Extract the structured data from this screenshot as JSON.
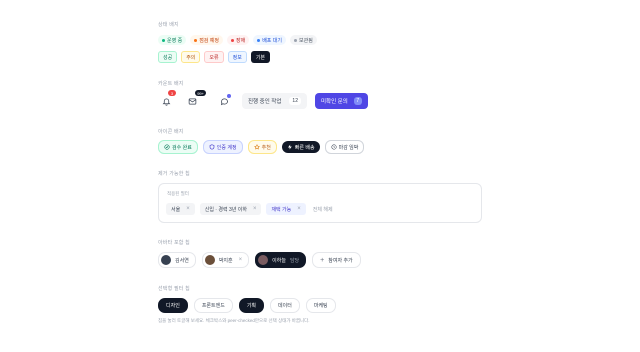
{
  "sections": {
    "status": "상태 배지",
    "counter": "카운트 배지",
    "icon": "아이콘 배지",
    "removable": "제거 가능한 칩",
    "avatar": "아바타 포함 칩",
    "selectable": "선택형 필터 칩"
  },
  "status_badges": [
    {
      "label": "운영 중",
      "variant": "green"
    },
    {
      "label": "점검 예정",
      "variant": "orange"
    },
    {
      "label": "장애",
      "variant": "red"
    },
    {
      "label": "배포 대기",
      "variant": "blue"
    },
    {
      "label": "보관됨",
      "variant": "gray"
    }
  ],
  "tone_badges": [
    {
      "label": "성공",
      "variant": "success"
    },
    {
      "label": "주의",
      "variant": "warn"
    },
    {
      "label": "오류",
      "variant": "err"
    },
    {
      "label": "정보",
      "variant": "info"
    },
    {
      "label": "기본",
      "variant": "def"
    }
  ],
  "counters": {
    "bell_count": "3",
    "mail_count": "99+",
    "in_progress_label": "진행 중인 작업",
    "in_progress_count": "12",
    "unread_label": "미확인 문의",
    "unread_count": "7"
  },
  "icon_badges": [
    {
      "label": "검수 완료",
      "icon": "check-circle-icon",
      "variant": "green"
    },
    {
      "label": "인증 계정",
      "icon": "shield-icon",
      "variant": "blue"
    },
    {
      "label": "추천",
      "icon": "star-icon",
      "variant": "amber"
    },
    {
      "label": "빠른 배송",
      "icon": "bolt-icon",
      "variant": "dark"
    },
    {
      "label": "마감 임박",
      "icon": "clock-icon",
      "variant": "white"
    }
  ],
  "removable": {
    "placeholder": "적용된 필터",
    "chips": [
      {
        "label": "서울",
        "variant": "gray"
      },
      {
        "label": "신입 · 경력 3년 이하",
        "variant": "gray"
      },
      {
        "label": "재택 가능",
        "variant": "indigo"
      }
    ],
    "clear_all": "전체 해제"
  },
  "people": [
    {
      "name": "김서연",
      "role": "",
      "variant": "light",
      "removable": false,
      "avatar_color": "#374151"
    },
    {
      "name": "박지훈",
      "role": "",
      "variant": "light",
      "removable": true,
      "avatar_color": "#6b4f3a"
    },
    {
      "name": "이하늘",
      "role": "담당",
      "variant": "dark",
      "removable": true,
      "avatar_color": "#7a5c61"
    }
  ],
  "add_person": "참여자 추가",
  "filters": [
    {
      "label": "디자인",
      "selected": true
    },
    {
      "label": "프론트엔드",
      "selected": false
    },
    {
      "label": "기획",
      "selected": true
    },
    {
      "label": "데이터",
      "selected": false
    },
    {
      "label": "마케팅",
      "selected": false
    }
  ],
  "hint": "칩을 눌러 토글해 보세요. 체크박스와 peer-checked만으로 선택 상태가 바뀝니다."
}
